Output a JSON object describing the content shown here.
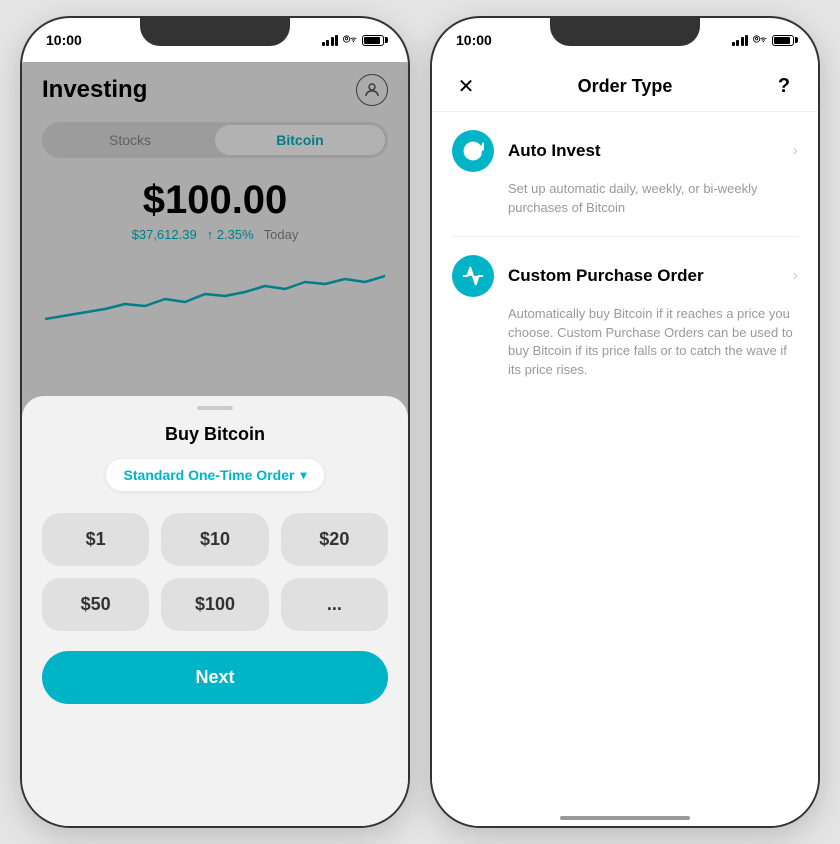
{
  "left_phone": {
    "status": {
      "time": "10:00"
    },
    "title": "Investing",
    "tabs": [
      {
        "label": "Stocks",
        "active": false
      },
      {
        "label": "Bitcoin",
        "active": true
      }
    ],
    "main_price": "$100.00",
    "btc_price": "$37,612.39",
    "change": "↑ 2.35%",
    "period": "Today",
    "sheet": {
      "title": "Buy Bitcoin",
      "order_type": "Standard One-Time Order",
      "amounts": [
        "$1",
        "$10",
        "$20",
        "$50",
        "$100",
        "..."
      ],
      "next_button": "Next"
    }
  },
  "right_phone": {
    "status": {
      "time": "10:00"
    },
    "nav": {
      "close": "✕",
      "title": "Order Type",
      "help": "?"
    },
    "options": [
      {
        "id": "auto-invest",
        "icon": "refresh",
        "title": "Auto Invest",
        "description": "Set up automatic daily, weekly, or bi-weekly purchases of Bitcoin"
      },
      {
        "id": "custom-purchase",
        "icon": "custom",
        "title": "Custom Purchase Order",
        "description": "Automatically buy Bitcoin if it reaches a price you choose. Custom Purchase Orders can be used to buy Bitcoin if its price falls or to catch the wave if its price rises."
      }
    ]
  }
}
